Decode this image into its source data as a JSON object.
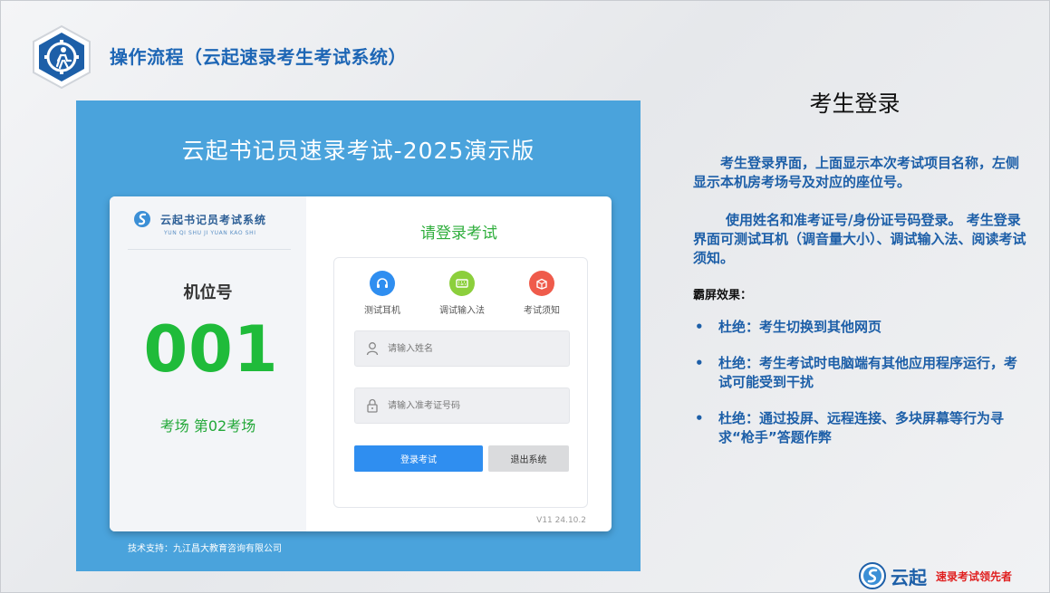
{
  "header": {
    "title": "操作流程（云起速录考生考试系统）",
    "logo_icon": "gear-person-icon"
  },
  "app": {
    "window_title": "云起书记员速录考试-2025演示版",
    "brand_name": "云起书记员考试系统",
    "brand_pinyin": "YUN QI SHU JI YUAN KAO SHI",
    "seat_label": "机位号",
    "seat_number": "001",
    "room_label": "考场 第02考场",
    "login_title": "请登录考试",
    "tools": [
      {
        "label": "测试耳机",
        "icon": "headset-icon",
        "color": "#2f8ef0"
      },
      {
        "label": "调试输入法",
        "icon": "keyboard-icon",
        "color": "#8ccf3c"
      },
      {
        "label": "考试须知",
        "icon": "notice-box-icon",
        "color": "#ef5b4b"
      }
    ],
    "name_placeholder": "请输入姓名",
    "id_placeholder": "请输入准考证号码",
    "login_button": "登录考试",
    "exit_button": "退出系统",
    "version": "V11 24.10.2",
    "support": "技术支持：九江昌大教育咨询有限公司"
  },
  "notes": {
    "title": "考生登录",
    "para1": "考生登录界面，上面显示本次考试项目名称，左侧显示本机房考场号及对应的座位号。",
    "para2": "使用姓名和准考证号/身份证号码登录。 考生登录界面可测试耳机（调音量大小）、调试输入法、阅读考试须知。",
    "effect_label": "霸屏效果：",
    "bullets": [
      "杜绝：考生切换到其他网页",
      "杜绝：考生考试时电脑端有其他应用程序运行，考试可能受到干扰",
      "杜绝：通过投屏、远程连接、多块屏幕等行为寻求“枪手”答题作弊"
    ]
  },
  "footer": {
    "brand": "云起",
    "slogan": "速录考试领先者"
  },
  "colors": {
    "accent_blue": "#1d5fa8",
    "panel_blue": "#4aa3dc",
    "seat_green": "#1fbb3a",
    "login_button": "#2f8ef0",
    "slogan_red": "#e02020"
  }
}
